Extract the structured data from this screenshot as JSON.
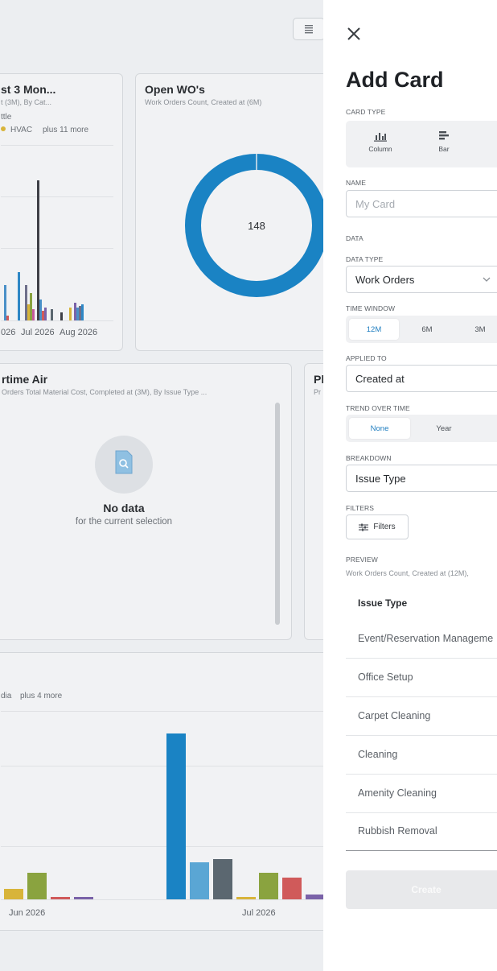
{
  "dashboard": {
    "card1": {
      "title": "st 3 Mon...",
      "subtitle": "t (3M), By Cat...",
      "legend_a": "ttle",
      "legend_b": "HVAC",
      "legend_more": "plus 11 more",
      "x_ticks": [
        "026",
        "Jul 2026",
        "Aug 2026"
      ]
    },
    "card2": {
      "title": "Open WO's",
      "subtitle": "Work Orders Count, Created at (6M)",
      "donut_value": "148",
      "chart_data": {
        "type": "pie",
        "title": "Open WO's",
        "categories": [
          "Open"
        ],
        "values": [
          148
        ],
        "center_label": "148",
        "color": "#1a83c4"
      }
    },
    "card3": {
      "title": "rtime Air",
      "subtitle": "Orders Total Material Cost, Completed at (3M), By Issue Type ...",
      "empty_title": "No data",
      "empty_subtitle": "for the current selection"
    },
    "card4": {
      "title": "Pl",
      "subtitle": "Pr"
    },
    "card5": {
      "legend_a": "dia",
      "legend_more": "plus 4 more",
      "x_ticks": [
        "Jun 2026",
        "Jul 2026"
      ]
    },
    "card1_chart_data": {
      "type": "bar",
      "categories": [
        "026",
        "Jul 2026",
        "Aug 2026"
      ],
      "series": [
        {
          "name": "HVAC",
          "values": [
            3,
            1,
            2
          ]
        }
      ]
    },
    "card5_chart_data": {
      "type": "bar",
      "categories": [
        "Jun 2026",
        "Jul 2026"
      ],
      "series": []
    },
    "list_view_icon": "list-icon"
  },
  "panel": {
    "close_icon": "close-icon",
    "title": "Add Card",
    "card_type_label": "CARD TYPE",
    "card_types": [
      "Column",
      "Bar"
    ],
    "name_label": "NAME",
    "name_placeholder": "My Card",
    "data_label": "DATA",
    "data_type_label": "DATA TYPE",
    "data_type_value": "Work Orders",
    "time_window_label": "TIME WINDOW",
    "time_window_options": [
      "12M",
      "6M",
      "3M"
    ],
    "time_window_selected": "12M",
    "applied_to_label": "APPLIED TO",
    "applied_to_value": "Created at",
    "trend_label": "TREND OVER TIME",
    "trend_options": [
      "None",
      "Year"
    ],
    "trend_selected": "None",
    "breakdown_label": "BREAKDOWN",
    "breakdown_value": "Issue Type",
    "filters_label": "FILTERS",
    "filters_button": "Filters",
    "preview_label": "PREVIEW",
    "preview_subtitle": "Work Orders Count, Created at (12M),",
    "preview_header": "Issue Type",
    "preview_rows": [
      "Event/Reservation Manageme",
      "Office Setup",
      "Carpet Cleaning",
      "Cleaning",
      "Amenity Cleaning",
      "Rubbish Removal"
    ],
    "create_button": "Create",
    "accent_color": "#1f7ec0"
  }
}
